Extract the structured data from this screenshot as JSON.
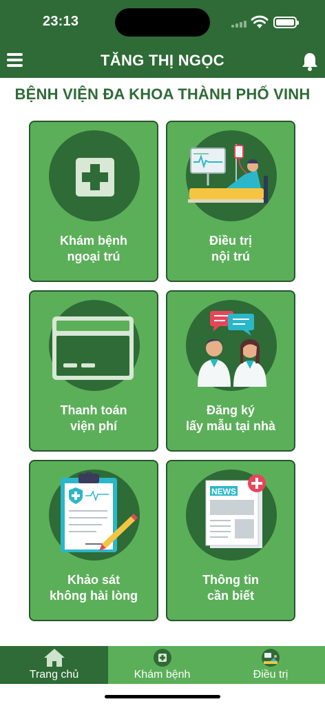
{
  "status_bar": {
    "time": "23:13"
  },
  "header": {
    "title": "TĂNG THỊ NGỌC"
  },
  "hospital": {
    "name": "BỆNH VIỆN ĐA KHOA THÀNH PHỐ VINH"
  },
  "tiles": [
    {
      "line1": "Khám bệnh",
      "line2": "ngoại trú",
      "icon": "medical-cross-icon"
    },
    {
      "line1": "Điều trị",
      "line2": "nội trú",
      "icon": "inpatient-bed-icon"
    },
    {
      "line1": "Thanh toán",
      "line2": "viện phí",
      "icon": "credit-card-icon"
    },
    {
      "line1": "Đăng ký",
      "line2": "lấy mẫu tại nhà",
      "icon": "doctors-chat-icon"
    },
    {
      "line1": "Khảo sát",
      "line2": "không hài lòng",
      "icon": "clipboard-survey-icon"
    },
    {
      "line1": "Thông tin",
      "line2": "cần biết",
      "icon": "newspaper-icon"
    }
  ],
  "tabbar": {
    "tabs": [
      {
        "label": "Trang chủ",
        "icon": "home-icon",
        "active": true
      },
      {
        "label": "Khám bệnh",
        "icon": "medical-cross-icon",
        "active": false
      },
      {
        "label": "Điều trị",
        "icon": "inpatient-bed-icon",
        "active": false
      }
    ]
  },
  "colors": {
    "primary_dark": "#2e6b36",
    "tile_green": "#5baf59",
    "accent_red": "#e8455a"
  },
  "news_label": "NEWS"
}
